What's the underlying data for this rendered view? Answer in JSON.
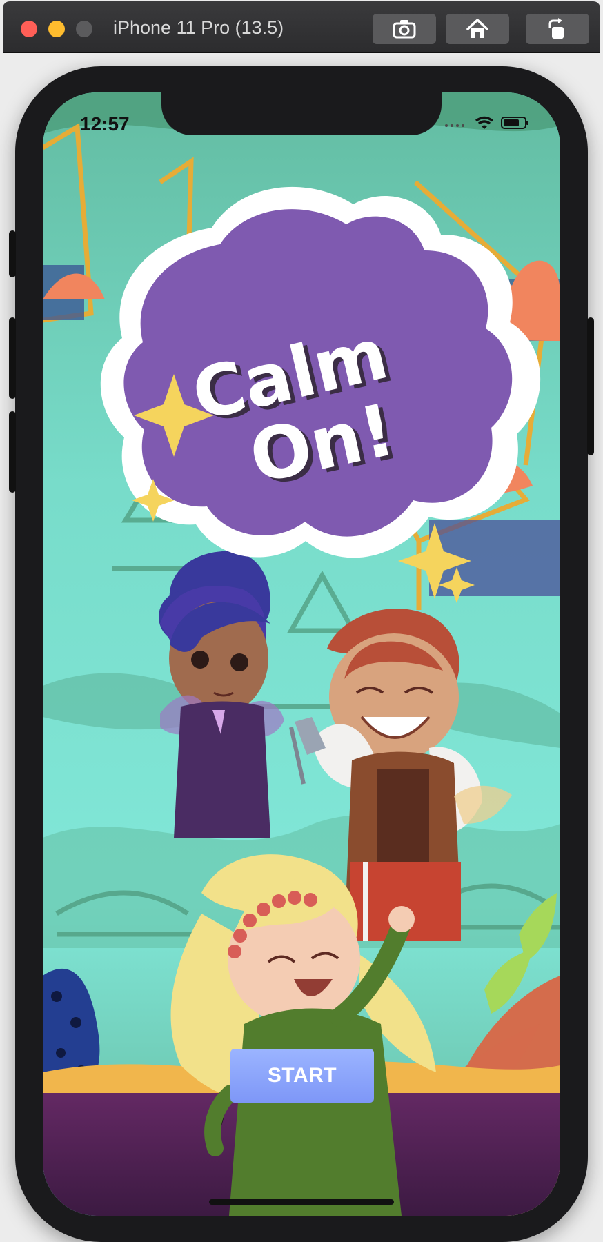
{
  "window": {
    "title": "iPhone 11 Pro (13.5)",
    "buttons": [
      {
        "icon": "camera-icon"
      },
      {
        "icon": "home-icon"
      },
      {
        "icon": "rotate-icon"
      }
    ]
  },
  "status_bar": {
    "time": "12:57",
    "signal_icon": "cellular-signal-icon",
    "wifi_icon": "wifi-icon",
    "battery_icon": "battery-icon"
  },
  "logo": {
    "line1": "Calm",
    "line2": "On!"
  },
  "start": {
    "label": "START"
  },
  "colors": {
    "logo_purple": "#7f5ab0",
    "start_button": "#8ea7fb",
    "background_teal": "#70d8c7"
  }
}
